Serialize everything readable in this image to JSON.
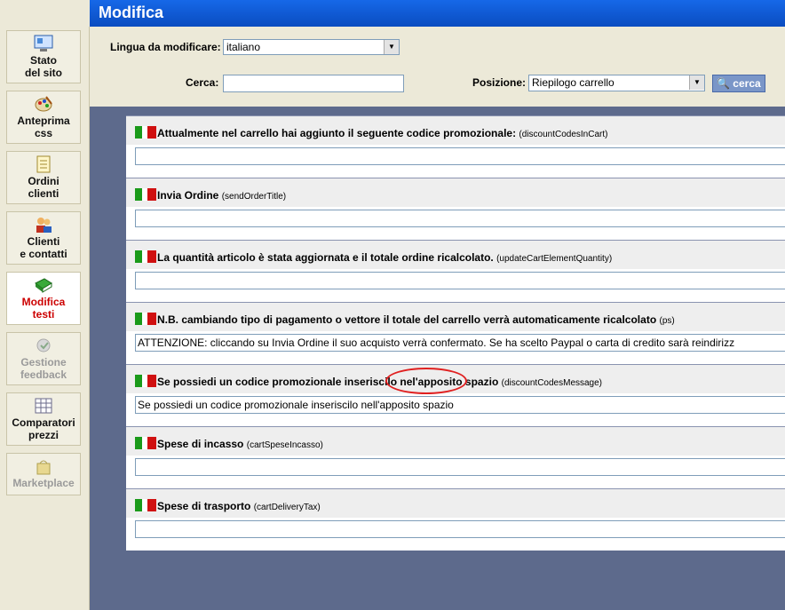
{
  "header": {
    "title": "Modifica"
  },
  "sidebar": {
    "items": [
      {
        "line1": "Stato",
        "line2": "del sito",
        "icon": "monitor-icon"
      },
      {
        "line1": "Anteprima",
        "line2": "css",
        "icon": "palette-icon"
      },
      {
        "line1": "Ordini",
        "line2": "clienti",
        "icon": "document-icon"
      },
      {
        "line1": "Clienti",
        "line2": "e contatti",
        "icon": "users-icon"
      },
      {
        "line1": "Modifica",
        "line2": "testi",
        "icon": "book-icon",
        "active": true
      },
      {
        "line1": "Gestione",
        "line2": "feedback",
        "icon": "feedback-icon",
        "disabled": true
      },
      {
        "line1": "Comparatori",
        "line2": "prezzi",
        "icon": "grid-icon"
      },
      {
        "line1": "Marketplace",
        "line2": "",
        "icon": "bag-icon",
        "disabled": true
      }
    ]
  },
  "filters": {
    "language_label": "Lingua da modificare:",
    "language_value": "italiano",
    "search_label": "Cerca:",
    "search_value": "",
    "position_label": "Posizione:",
    "position_value": "Riepilogo carrello",
    "search_button": "cerca"
  },
  "rows": [
    {
      "label": "Attualmente nel carrello hai aggiunto il seguente codice promozionale:",
      "key": "(discountCodesInCart)",
      "value": ""
    },
    {
      "label": "Invia Ordine",
      "key": "(sendOrderTitle)",
      "value": ""
    },
    {
      "label": "La quantità articolo è stata aggiornata e il totale ordine ricalcolato.",
      "key": "(updateCartElementQuantity)",
      "value": ""
    },
    {
      "label": "N.B. cambiando tipo di pagamento o vettore il totale del carrello verrà automaticamente ricalcolato",
      "key": "(ps)",
      "value": "ATTENZIONE: cliccando su Invia Ordine il suo acquisto verrà confermato. Se ha scelto Paypal o carta di credito sarà reindirizz"
    },
    {
      "label": "Se possiedi un codice promozionale inseriscilo nel'apposito spazio",
      "key": "(discountCodesMessage)",
      "value": "Se possiedi un codice promozionale inseriscilo nell'apposito spazio"
    },
    {
      "label": "Spese di incasso",
      "key": "(cartSpeseIncasso)",
      "value": ""
    },
    {
      "label": "Spese di trasporto",
      "key": "(cartDeliveryTax)",
      "value": ""
    }
  ],
  "colors": {
    "title_bar": "#0b52c9",
    "content_bg": "#5d6a8c",
    "sidebar_bg": "#ece9d8",
    "active_text": "#cc0000",
    "annotation": "#e02020"
  }
}
